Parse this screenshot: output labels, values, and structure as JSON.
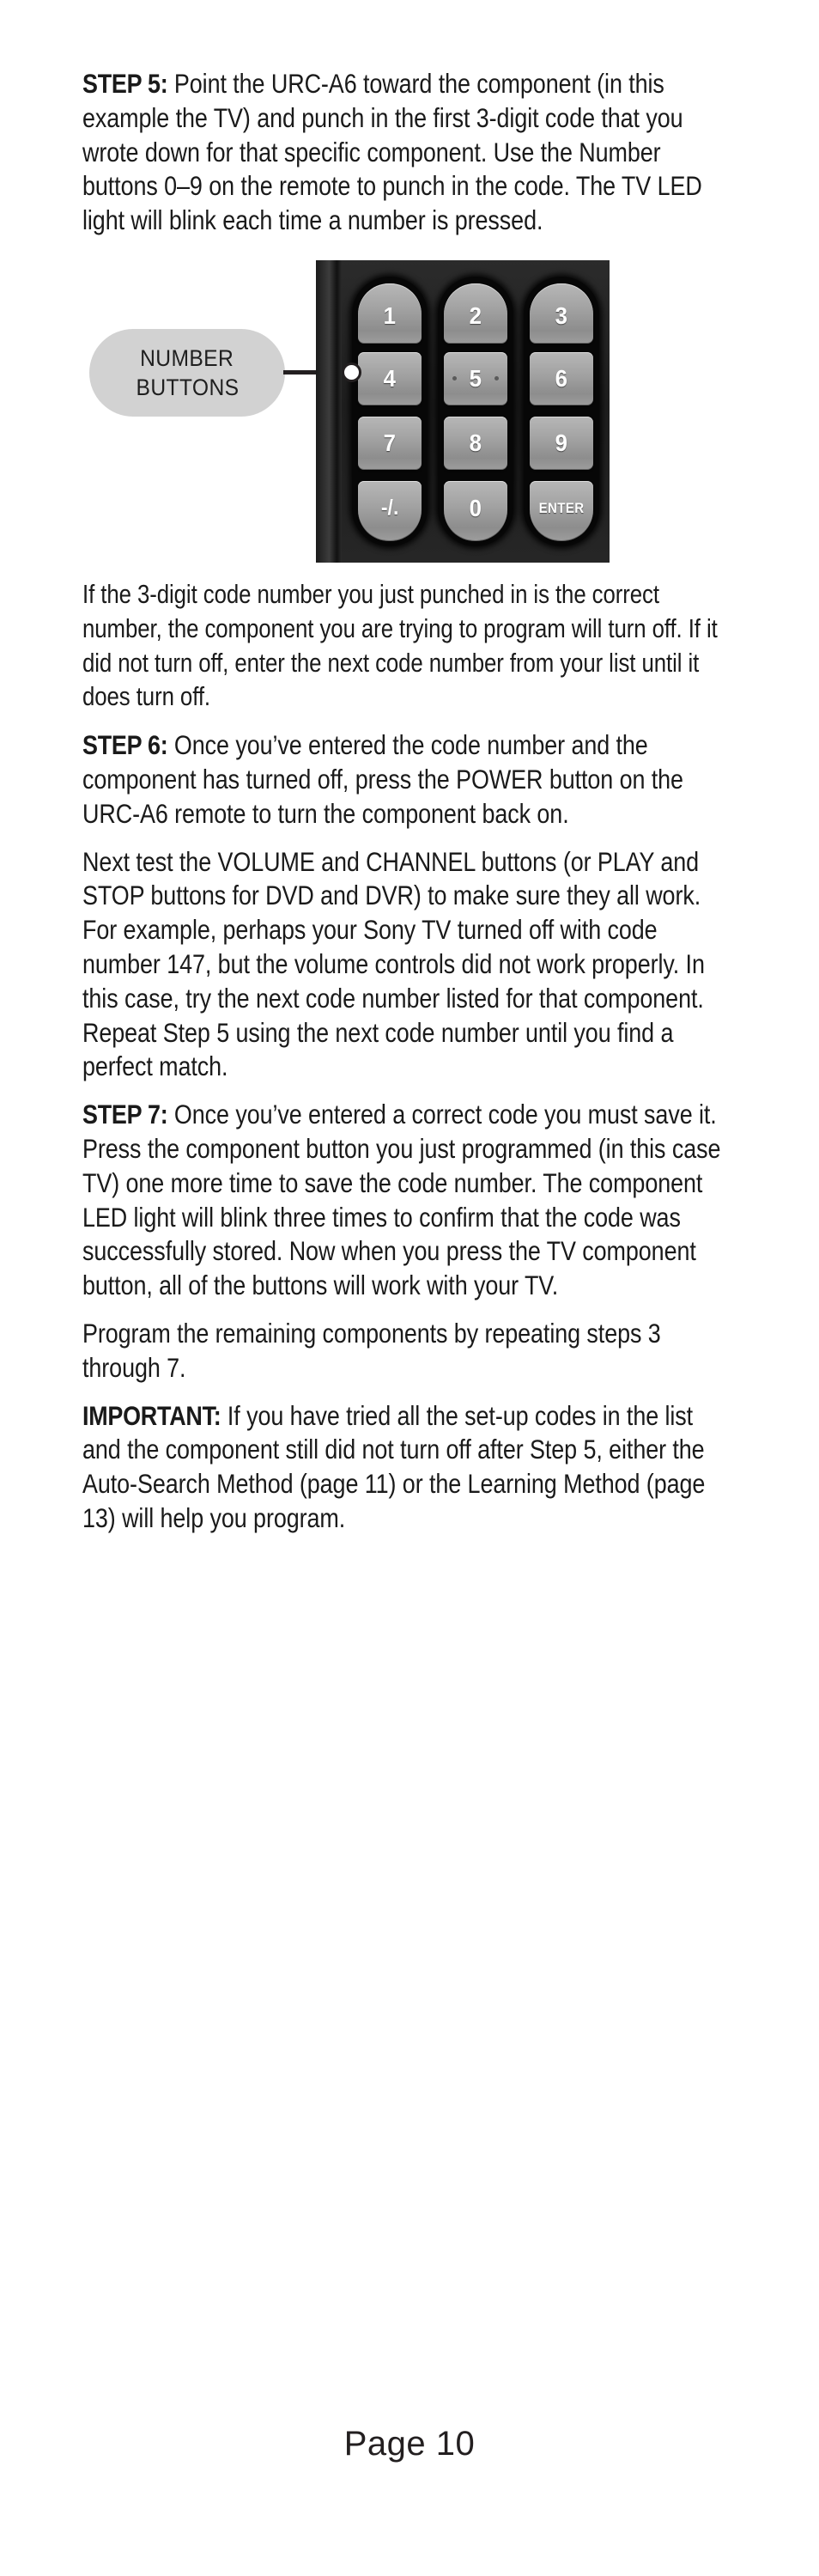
{
  "document": {
    "page_label": "Page 10"
  },
  "paragraphs": [
    {
      "id": "step5",
      "lead": "STEP 5:",
      "text": " Point the URC-A6 toward the component (in this example the TV) and punch in the first 3-digit code that you wrote down for that specific component. Use the Number buttons 0–9 on the remote to punch in the code. The TV LED light will blink each time a number is pressed."
    },
    {
      "id": "confirm-code",
      "lead": "",
      "text": "If the 3-digit code number you just punched in is the correct number, the component you are trying to program will turn off. If it did not turn off, enter the next code number from your list until it does turn off."
    },
    {
      "id": "step6",
      "lead": "STEP 6:",
      "text": " Once you’ve entered the code number and the component has turned off, press the POWER button on the URC-A6 remote to turn the component back on."
    },
    {
      "id": "test-buttons",
      "lead": "",
      "text": "Next test the VOLUME and CHANNEL buttons (or PLAY and STOP buttons for DVD and DVR) to make sure they all work. For example, perhaps your Sony TV turned off with code number 147, but the volume controls did not work properly. In this case, try the next code number listed for that component. Repeat Step 5 using the next code number until you find a perfect match."
    },
    {
      "id": "step7",
      "lead": "STEP 7:",
      "text": " Once you’ve entered a correct code you must save it. Press the component button you just programmed (in this case TV) one more time to save the code number. The component LED light will blink three times to confirm that the code was successfully stored. Now when you press the TV component button, all of the buttons will work with your TV."
    },
    {
      "id": "repeat",
      "lead": "",
      "text": "Program the remaining components by repeating steps 3 through 7."
    },
    {
      "id": "important",
      "lead": "IMPORTANT:",
      "text": " If you have tried all the set-up codes in the list and the component still did not turn off after Step 5, either the Auto-Search Method (page 11) or the Learning Method (page 13) will help you program."
    }
  ],
  "figure": {
    "callout": {
      "line1": "NUMBER",
      "line2": "BUTTONS"
    },
    "keypad": {
      "columns": [
        {
          "keys": [
            "1",
            "4",
            "7",
            "-/."
          ]
        },
        {
          "keys": [
            "2",
            "5",
            "8",
            "0"
          ]
        },
        {
          "keys": [
            "3",
            "6",
            "9",
            "ENTER"
          ]
        }
      ]
    }
  },
  "colors": {
    "page_background": "#ffffff",
    "text": "#1a1a1a",
    "callout_background": "#d2d2d2",
    "keypad_body": "#1e1e1e",
    "key_face": "#a2a2a2",
    "key_label": "#ffffff",
    "leader_line": "#231f20"
  }
}
